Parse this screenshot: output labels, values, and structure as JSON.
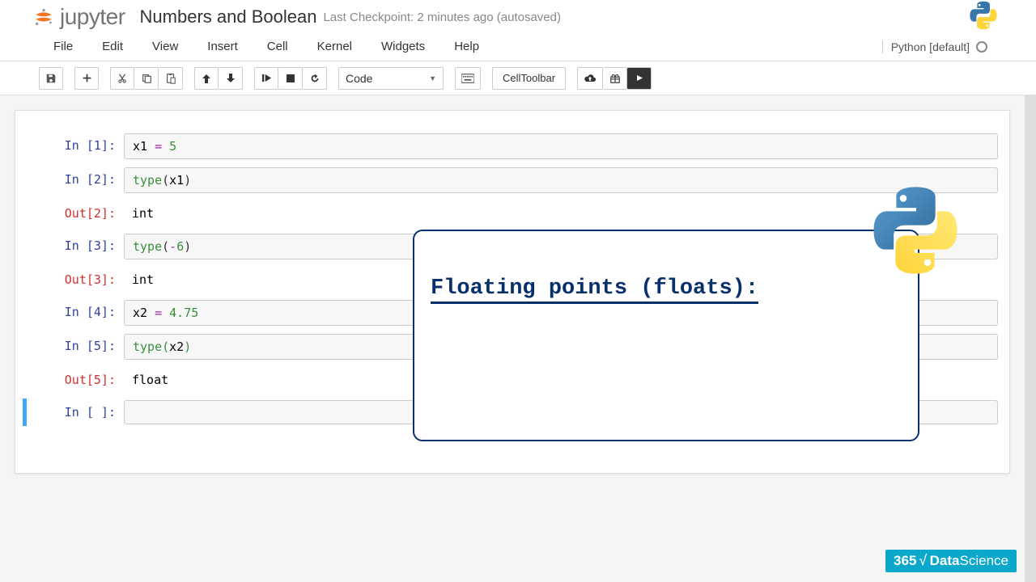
{
  "header": {
    "logo_text": "jupyter",
    "title": "Numbers and Boolean",
    "checkpoint": "Last Checkpoint: 2 minutes ago (autosaved)"
  },
  "menu": {
    "items": [
      "File",
      "Edit",
      "View",
      "Insert",
      "Cell",
      "Kernel",
      "Widgets",
      "Help"
    ],
    "kernel_name": "Python [default]"
  },
  "toolbar": {
    "celltype": "Code",
    "celltoolbar": "CellToolbar"
  },
  "cells": [
    {
      "in_label": "In [1]:",
      "code_html": "x1 <span class='k-op'>=</span> <span class='k-num'>5</span>"
    },
    {
      "in_label": "In [2]:",
      "code_html": "<span class='k-func'>type</span><span class='k-paren'>(</span>x1<span class='k-paren'>)</span>",
      "out_label": "Out[2]:",
      "out": "int"
    },
    {
      "in_label": "In [3]:",
      "code_html": "<span class='k-func'>type</span><span class='k-paren'>(</span><span class='k-op'>-</span><span class='k-num'>6</span><span class='k-paren'>)</span>",
      "out_label": "Out[3]:",
      "out": "int"
    },
    {
      "in_label": "In [4]:",
      "code_html": "x2 <span class='k-op'>=</span> <span class='k-num'>4.75</span>"
    },
    {
      "in_label": "In [5]:",
      "code_html": "<span class='k-func'>type</span><span class='k-paren' style='color:#388E3C'>(</span>x2<span class='k-paren' style='color:#388E3C'>)</span>",
      "out_label": "Out[5]:",
      "out": "float"
    },
    {
      "in_label": "In [ ]:",
      "code_html": "",
      "selected": true
    }
  ],
  "overlay": {
    "title": "Floating points (floats):"
  },
  "watermark": {
    "num": "365",
    "check": "√",
    "brand": "DataScience"
  }
}
